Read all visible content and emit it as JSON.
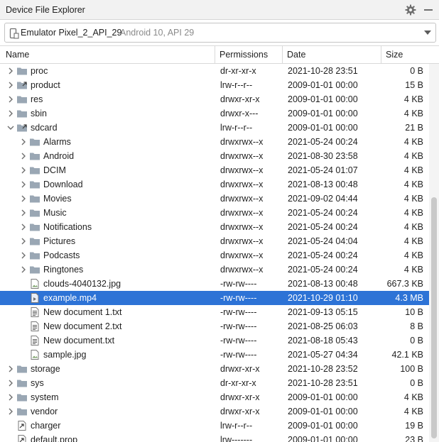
{
  "window": {
    "title": "Device File Explorer",
    "gear_icon": "gear-icon",
    "minimize_icon": "minimize-icon"
  },
  "device": {
    "name": "Emulator Pixel_2_API_29",
    "version": "Android 10, API 29"
  },
  "columns": {
    "name": "Name",
    "permissions": "Permissions",
    "date": "Date",
    "size": "Size"
  },
  "colors": {
    "selection": "#2d73d6",
    "folder": "#9aa7b4",
    "accent": "#2d73d6"
  },
  "rows": [
    {
      "name": "proc",
      "perm": "dr-xr-xr-x",
      "date": "2021-10-28 23:51",
      "size": "0 B",
      "depth": 0,
      "type": "folder",
      "expander": "collapsed",
      "selected": false
    },
    {
      "name": "product",
      "perm": "lrw-r--r--",
      "date": "2009-01-01 00:00",
      "size": "15 B",
      "depth": 0,
      "type": "link-folder",
      "expander": "collapsed",
      "selected": false
    },
    {
      "name": "res",
      "perm": "drwxr-xr-x",
      "date": "2009-01-01 00:00",
      "size": "4 KB",
      "depth": 0,
      "type": "folder",
      "expander": "collapsed",
      "selected": false
    },
    {
      "name": "sbin",
      "perm": "drwxr-x---",
      "date": "2009-01-01 00:00",
      "size": "4 KB",
      "depth": 0,
      "type": "folder",
      "expander": "collapsed",
      "selected": false
    },
    {
      "name": "sdcard",
      "perm": "lrw-r--r--",
      "date": "2009-01-01 00:00",
      "size": "21 B",
      "depth": 0,
      "type": "link-folder",
      "expander": "expanded",
      "selected": false
    },
    {
      "name": "Alarms",
      "perm": "drwxrwx--x",
      "date": "2021-05-24 00:24",
      "size": "4 KB",
      "depth": 1,
      "type": "folder",
      "expander": "collapsed",
      "selected": false
    },
    {
      "name": "Android",
      "perm": "drwxrwx--x",
      "date": "2021-08-30 23:58",
      "size": "4 KB",
      "depth": 1,
      "type": "folder",
      "expander": "collapsed",
      "selected": false
    },
    {
      "name": "DCIM",
      "perm": "drwxrwx--x",
      "date": "2021-05-24 01:07",
      "size": "4 KB",
      "depth": 1,
      "type": "folder",
      "expander": "collapsed",
      "selected": false
    },
    {
      "name": "Download",
      "perm": "drwxrwx--x",
      "date": "2021-08-13 00:48",
      "size": "4 KB",
      "depth": 1,
      "type": "folder",
      "expander": "collapsed",
      "selected": false
    },
    {
      "name": "Movies",
      "perm": "drwxrwx--x",
      "date": "2021-09-02 04:44",
      "size": "4 KB",
      "depth": 1,
      "type": "folder",
      "expander": "collapsed",
      "selected": false
    },
    {
      "name": "Music",
      "perm": "drwxrwx--x",
      "date": "2021-05-24 00:24",
      "size": "4 KB",
      "depth": 1,
      "type": "folder",
      "expander": "collapsed",
      "selected": false
    },
    {
      "name": "Notifications",
      "perm": "drwxrwx--x",
      "date": "2021-05-24 00:24",
      "size": "4 KB",
      "depth": 1,
      "type": "folder",
      "expander": "collapsed",
      "selected": false
    },
    {
      "name": "Pictures",
      "perm": "drwxrwx--x",
      "date": "2021-05-24 04:04",
      "size": "4 KB",
      "depth": 1,
      "type": "folder",
      "expander": "collapsed",
      "selected": false
    },
    {
      "name": "Podcasts",
      "perm": "drwxrwx--x",
      "date": "2021-05-24 00:24",
      "size": "4 KB",
      "depth": 1,
      "type": "folder",
      "expander": "collapsed",
      "selected": false
    },
    {
      "name": "Ringtones",
      "perm": "drwxrwx--x",
      "date": "2021-05-24 00:24",
      "size": "4 KB",
      "depth": 1,
      "type": "folder",
      "expander": "collapsed",
      "selected": false
    },
    {
      "name": "clouds-4040132.jpg",
      "perm": "-rw-rw----",
      "date": "2021-08-13 00:48",
      "size": "667.3 KB",
      "depth": 1,
      "type": "image",
      "expander": "none",
      "selected": false
    },
    {
      "name": "example.mp4",
      "perm": "-rw-rw----",
      "date": "2021-10-29 01:10",
      "size": "4.3 MB",
      "depth": 1,
      "type": "video",
      "expander": "none",
      "selected": true
    },
    {
      "name": "New document 1.txt",
      "perm": "-rw-rw----",
      "date": "2021-09-13 05:15",
      "size": "10 B",
      "depth": 1,
      "type": "text",
      "expander": "none",
      "selected": false
    },
    {
      "name": "New document 2.txt",
      "perm": "-rw-rw----",
      "date": "2021-08-25 06:03",
      "size": "8 B",
      "depth": 1,
      "type": "text",
      "expander": "none",
      "selected": false
    },
    {
      "name": "New document.txt",
      "perm": "-rw-rw----",
      "date": "2021-08-18 05:43",
      "size": "0 B",
      "depth": 1,
      "type": "text",
      "expander": "none",
      "selected": false
    },
    {
      "name": "sample.jpg",
      "perm": "-rw-rw----",
      "date": "2021-05-27 04:34",
      "size": "42.1 KB",
      "depth": 1,
      "type": "image",
      "expander": "none",
      "selected": false
    },
    {
      "name": "storage",
      "perm": "drwxr-xr-x",
      "date": "2021-10-28 23:52",
      "size": "100 B",
      "depth": 0,
      "type": "folder",
      "expander": "collapsed",
      "selected": false
    },
    {
      "name": "sys",
      "perm": "dr-xr-xr-x",
      "date": "2021-10-28 23:51",
      "size": "0 B",
      "depth": 0,
      "type": "folder",
      "expander": "collapsed",
      "selected": false
    },
    {
      "name": "system",
      "perm": "drwxr-xr-x",
      "date": "2009-01-01 00:00",
      "size": "4 KB",
      "depth": 0,
      "type": "folder",
      "expander": "collapsed",
      "selected": false
    },
    {
      "name": "vendor",
      "perm": "drwxr-xr-x",
      "date": "2009-01-01 00:00",
      "size": "4 KB",
      "depth": 0,
      "type": "folder",
      "expander": "collapsed",
      "selected": false
    },
    {
      "name": "charger",
      "perm": "lrw-r--r--",
      "date": "2009-01-01 00:00",
      "size": "19 B",
      "depth": 0,
      "type": "link-file",
      "expander": "none",
      "selected": false
    },
    {
      "name": "default.prop",
      "perm": "lrw-------",
      "date": "2009-01-01 00:00",
      "size": "23 B",
      "depth": 0,
      "type": "link-file",
      "expander": "none",
      "selected": false
    }
  ]
}
